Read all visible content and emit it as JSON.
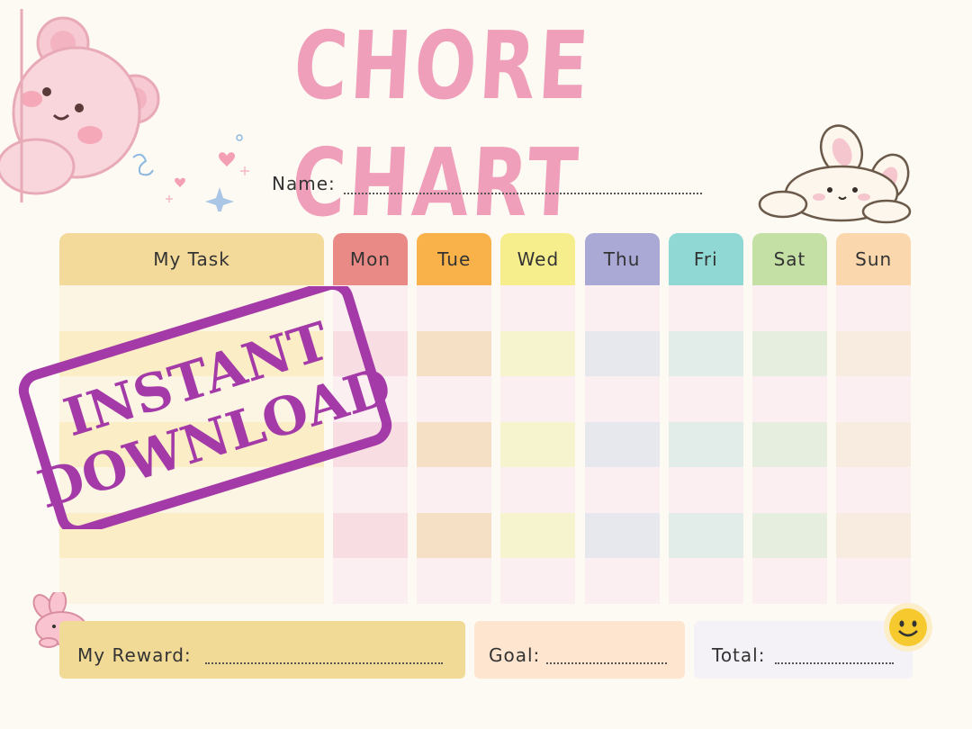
{
  "title": "CHORE CHART",
  "name_label": "Name:",
  "task_header": "My Task",
  "days": [
    {
      "label": "Mon",
      "header_color": "#ea8a86",
      "tint_a": "#fbeff2",
      "tint_b": "#f8dde2"
    },
    {
      "label": "Tue",
      "header_color": "#f9b24a",
      "tint_a": "#fbeff2",
      "tint_b": "#f6e0c5"
    },
    {
      "label": "Wed",
      "header_color": "#f6ee8d",
      "tint_a": "#fbeff2",
      "tint_b": "#f5f4cf"
    },
    {
      "label": "Thu",
      "header_color": "#aaa9d6",
      "tint_a": "#fbeff2",
      "tint_b": "#e7e7ee"
    },
    {
      "label": "Fri",
      "header_color": "#8fd8d4",
      "tint_a": "#fbeff2",
      "tint_b": "#e2ece9"
    },
    {
      "label": "Sat",
      "header_color": "#c5e0a5",
      "tint_a": "#fbeff2",
      "tint_b": "#e6eee0"
    },
    {
      "label": "Sun",
      "header_color": "#fad7ad",
      "tint_a": "#fbeff2",
      "tint_b": "#f8ebe0"
    }
  ],
  "task_colors": {
    "header": "#f4da9a",
    "tint_a": "#fcf5e4",
    "tint_b": "#fbeec6"
  },
  "row_count": 7,
  "reward_label": "My Reward:",
  "goal_label": "Goal:",
  "total_label": "Total:",
  "stamp": {
    "line1": "INSTANT",
    "line2": "DOWNLOAD",
    "color": "#a43aa7"
  },
  "colors": {
    "title": "#ef9fb9",
    "reward_bg": "#f1da96",
    "goal_bg": "#fde5cf",
    "total_bg": "#f4f1f7"
  }
}
